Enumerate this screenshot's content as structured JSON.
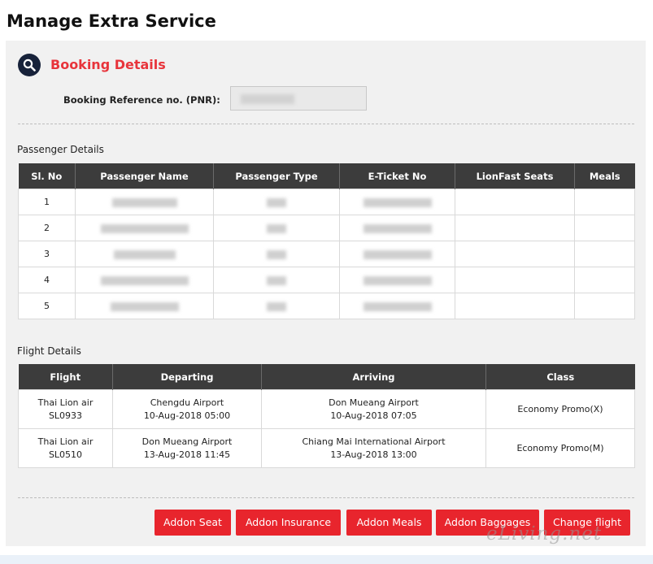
{
  "page": {
    "title": "Manage Extra Service"
  },
  "booking": {
    "section_title": "Booking Details",
    "pnr_label": "Booking Reference no. (PNR):",
    "pnr_value": ""
  },
  "passengers": {
    "label": "Passenger Details",
    "columns": [
      "Sl. No",
      "Passenger Name",
      "Passenger Type",
      "E-Ticket No",
      "LionFast Seats",
      "Meals"
    ],
    "rows": [
      {
        "sl": "1",
        "name": "",
        "type": "",
        "ticket": "",
        "seats": "",
        "meals": ""
      },
      {
        "sl": "2",
        "name": "",
        "type": "",
        "ticket": "",
        "seats": "",
        "meals": ""
      },
      {
        "sl": "3",
        "name": "",
        "type": "",
        "ticket": "",
        "seats": "",
        "meals": ""
      },
      {
        "sl": "4",
        "name": "",
        "type": "",
        "ticket": "",
        "seats": "",
        "meals": ""
      },
      {
        "sl": "5",
        "name": "",
        "type": "",
        "ticket": "",
        "seats": "",
        "meals": ""
      }
    ]
  },
  "flights": {
    "label": "Flight Details",
    "columns": [
      "Flight",
      "Departing",
      "Arriving",
      "Class"
    ],
    "rows": [
      {
        "airline": "Thai Lion air",
        "flight_no": "SL0933",
        "dep_airport": "Chengdu Airport",
        "dep_time": "10-Aug-2018 05:00",
        "arr_airport": "Don Mueang Airport",
        "arr_time": "10-Aug-2018 07:05",
        "class": "Economy Promo(X)"
      },
      {
        "airline": "Thai Lion air",
        "flight_no": "SL0510",
        "dep_airport": "Don Mueang Airport",
        "dep_time": "13-Aug-2018 11:45",
        "arr_airport": "Chiang Mai International Airport",
        "arr_time": "13-Aug-2018 13:00",
        "class": "Economy Promo(M)"
      }
    ]
  },
  "actions": {
    "addon_seat": "Addon Seat",
    "addon_insurance": "Addon Insurance",
    "addon_meals": "Addon Meals",
    "addon_baggages": "Addon Baggages",
    "change_flight": "Change flight"
  },
  "watermark": "eLiving.net",
  "icons": {
    "search": "search-icon"
  },
  "colors": {
    "accent": "#e8343b",
    "button": "#e8252d",
    "table_header": "#3c3c3c",
    "badge": "#17223a"
  }
}
